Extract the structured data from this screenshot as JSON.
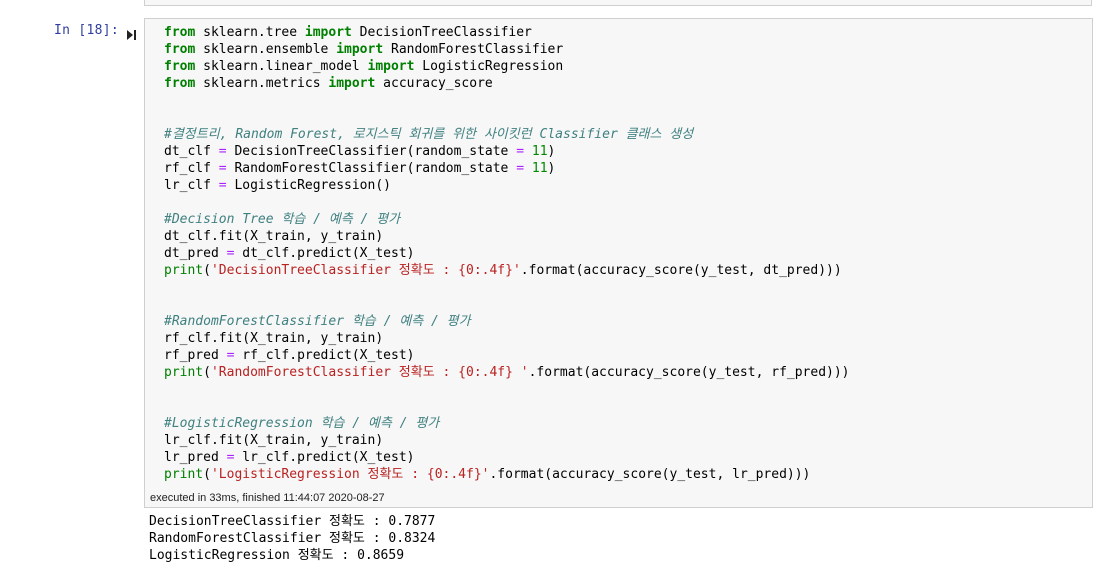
{
  "cell": {
    "prompt": "In [18]:",
    "code_lines": [
      [
        {
          "t": "from",
          "c": "kw"
        },
        {
          "t": " sklearn.tree "
        },
        {
          "t": "import",
          "c": "kw"
        },
        {
          "t": " DecisionTreeClassifier"
        }
      ],
      [
        {
          "t": "from",
          "c": "kw"
        },
        {
          "t": " sklearn.ensemble "
        },
        {
          "t": "import",
          "c": "kw"
        },
        {
          "t": " RandomForestClassifier"
        }
      ],
      [
        {
          "t": "from",
          "c": "kw"
        },
        {
          "t": " sklearn.linear_model "
        },
        {
          "t": "import",
          "c": "kw"
        },
        {
          "t": " LogisticRegression"
        }
      ],
      [
        {
          "t": "from",
          "c": "kw"
        },
        {
          "t": " sklearn.metrics "
        },
        {
          "t": "import",
          "c": "kw"
        },
        {
          "t": " accuracy_score"
        }
      ],
      [],
      [],
      [
        {
          "t": "#결정트리, Random Forest, 로지스틱 회귀를 위한 사이킷런 Classifier 클래스 생성",
          "c": "cm"
        }
      ],
      [
        {
          "t": "dt_clf "
        },
        {
          "t": "=",
          "c": "op"
        },
        {
          "t": " DecisionTreeClassifier(random_state "
        },
        {
          "t": "=",
          "c": "op"
        },
        {
          "t": " "
        },
        {
          "t": "11",
          "c": "nm"
        },
        {
          "t": ")"
        }
      ],
      [
        {
          "t": "rf_clf "
        },
        {
          "t": "=",
          "c": "op"
        },
        {
          "t": " RandomForestClassifier(random_state "
        },
        {
          "t": "=",
          "c": "op"
        },
        {
          "t": " "
        },
        {
          "t": "11",
          "c": "nm"
        },
        {
          "t": ")"
        }
      ],
      [
        {
          "t": "lr_clf "
        },
        {
          "t": "=",
          "c": "op"
        },
        {
          "t": " LogisticRegression()"
        }
      ],
      [],
      [
        {
          "t": "#Decision Tree 학습 / 예측 / 평가",
          "c": "cm"
        }
      ],
      [
        {
          "t": "dt_clf.fit(X_train, y_train)"
        }
      ],
      [
        {
          "t": "dt_pred "
        },
        {
          "t": "=",
          "c": "op"
        },
        {
          "t": " dt_clf.predict(X_test)"
        }
      ],
      [
        {
          "t": "print",
          "c": "nb"
        },
        {
          "t": "("
        },
        {
          "t": "'DecisionTreeClassifier 정확도 : {0:.4f}'",
          "c": "st"
        },
        {
          "t": ".format(accuracy_score(y_test, dt_pred)))"
        }
      ],
      [],
      [],
      [
        {
          "t": "#RandomForestClassifier 학습 / 예측 / 평가",
          "c": "cm"
        }
      ],
      [
        {
          "t": "rf_clf.fit(X_train, y_train)"
        }
      ],
      [
        {
          "t": "rf_pred "
        },
        {
          "t": "=",
          "c": "op"
        },
        {
          "t": " rf_clf.predict(X_test)"
        }
      ],
      [
        {
          "t": "print",
          "c": "nb"
        },
        {
          "t": "("
        },
        {
          "t": "'RandomForestClassifier 정확도 : {0:.4f} '",
          "c": "st"
        },
        {
          "t": ".format(accuracy_score(y_test, rf_pred)))"
        }
      ],
      [],
      [],
      [
        {
          "t": "#LogisticRegression 학습 / 예측 / 평가",
          "c": "cm"
        }
      ],
      [
        {
          "t": "lr_clf.fit(X_train, y_train)"
        }
      ],
      [
        {
          "t": "lr_pred "
        },
        {
          "t": "=",
          "c": "op"
        },
        {
          "t": " lr_clf.predict(X_test)"
        }
      ],
      [
        {
          "t": "print",
          "c": "nb"
        },
        {
          "t": "("
        },
        {
          "t": "'LogisticRegression 정확도 : {0:.4f}'",
          "c": "st"
        },
        {
          "t": ".format(accuracy_score(y_test, lr_pred)))"
        }
      ]
    ],
    "execution_info": "executed in 33ms, finished 11:44:07 2020-08-27",
    "output_lines": [
      "DecisionTreeClassifier 정확도 : 0.7877",
      "RandomForestClassifier 정확도 : 0.8324",
      "LogisticRegression 정확도 : 0.8659"
    ]
  },
  "icons": {
    "run": "run-cell-icon"
  },
  "colors": {
    "prompt": "#303f9f",
    "keyword": "#008000",
    "comment": "#408080",
    "string": "#ba2121",
    "cell_bg": "#f7f7f7",
    "cell_border": "#cfcfcf"
  }
}
